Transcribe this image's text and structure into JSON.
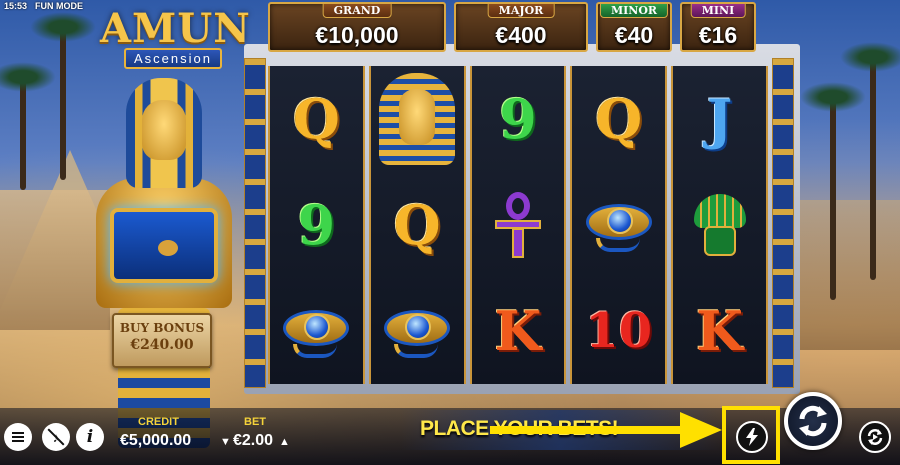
{
  "status": {
    "time": "15:53",
    "mode": "FUN MODE"
  },
  "logo": {
    "title": "AMUN",
    "subtitle": "Ascension"
  },
  "buy_bonus": {
    "label": "BUY BONUS",
    "price": "€240.00"
  },
  "jackpots": [
    {
      "label": "GRAND",
      "value": "€10,000",
      "color": "#8a4b1e"
    },
    {
      "label": "MAJOR",
      "value": "€400",
      "color": "#8a4b1e"
    },
    {
      "label": "MINOR",
      "value": "€40",
      "color": "#2fa048"
    },
    {
      "label": "MINI",
      "value": "€16",
      "color": "#9a2f8a"
    }
  ],
  "reels": [
    [
      "Q",
      "9",
      "eye-of-horus"
    ],
    [
      "pharaoh-mask",
      "Q",
      "eye-of-horus"
    ],
    [
      "9",
      "ankh",
      "K"
    ],
    [
      "Q",
      "eye-of-horus",
      "10"
    ],
    [
      "J",
      "lotus",
      "K"
    ]
  ],
  "bottom": {
    "credit_label": "CREDIT",
    "credit_value": "€5,000.00",
    "bet_label": "BET",
    "bet_value": "€2.00",
    "message": "PLACE YOUR BETS!"
  },
  "icons": {
    "menu": "hamburger-icon",
    "sound": "sound-muted-icon",
    "info": "info-icon",
    "turbo": "lightning-icon",
    "spin": "spin-arrows-icon",
    "autoplay": "autoplay-icon"
  },
  "colors": {
    "highlight": "#ffe000",
    "label_gold": "#f5d33a",
    "message": "#ffe84a"
  }
}
